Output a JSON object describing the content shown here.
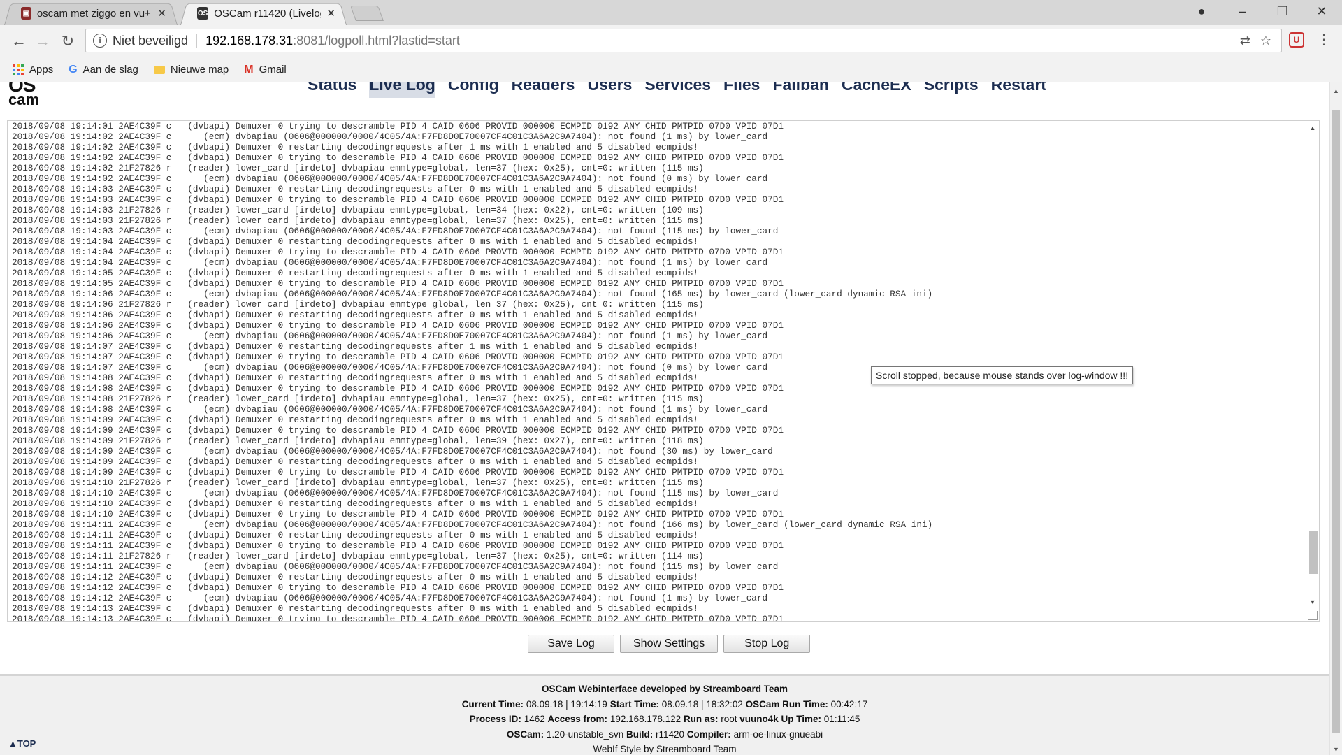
{
  "browser": {
    "tabs": [
      {
        "title": "oscam met ziggo en vu+ s",
        "favicon": "tv-icon",
        "active": false
      },
      {
        "title": "OSCam r11420 (Livelog)",
        "favicon": "oscam-icon",
        "active": true
      }
    ],
    "security_label": "Niet beveiligd",
    "url_host": "192.168.178.31",
    "url_rest": ":8081/logpoll.html?lastid=start",
    "bookmarks": [
      {
        "label": "Apps",
        "icon": "apps-grid-icon"
      },
      {
        "label": "Aan de slag",
        "icon": "google-icon"
      },
      {
        "label": "Nieuwe map",
        "icon": "folder-icon"
      },
      {
        "label": "Gmail",
        "icon": "gmail-icon"
      }
    ]
  },
  "oscam": {
    "logo_line1": "OS",
    "logo_line2": "cam",
    "menu": [
      "Status",
      "Live Log",
      "Config",
      "Readers",
      "Users",
      "Services",
      "Files",
      "Failban",
      "CacheEX",
      "Scripts",
      "Restart"
    ],
    "active_menu": "Live Log",
    "log_lines": [
      "2018/09/08 19:14:01 2AE4C39F c   (dvbapi) Demuxer 0 trying to descramble PID 4 CAID 0606 PROVID 000000 ECMPID 0192 ANY CHID PMTPID 07D0 VPID 07D1",
      "2018/09/08 19:14:02 2AE4C39F c      (ecm) dvbapiau (0606@000000/0000/4C05/4A:F7FD8D0E70007CF4C01C3A6A2C9A7404): not found (1 ms) by lower_card",
      "2018/09/08 19:14:02 2AE4C39F c   (dvbapi) Demuxer 0 restarting decodingrequests after 1 ms with 1 enabled and 5 disabled ecmpids!",
      "2018/09/08 19:14:02 2AE4C39F c   (dvbapi) Demuxer 0 trying to descramble PID 4 CAID 0606 PROVID 000000 ECMPID 0192 ANY CHID PMTPID 07D0 VPID 07D1",
      "2018/09/08 19:14:02 21F27826 r   (reader) lower_card [irdeto] dvbapiau emmtype=global, len=37 (hex: 0x25), cnt=0: written (115 ms)",
      "2018/09/08 19:14:02 2AE4C39F c      (ecm) dvbapiau (0606@000000/0000/4C05/4A:F7FD8D0E70007CF4C01C3A6A2C9A7404): not found (0 ms) by lower_card",
      "2018/09/08 19:14:03 2AE4C39F c   (dvbapi) Demuxer 0 restarting decodingrequests after 0 ms with 1 enabled and 5 disabled ecmpids!",
      "2018/09/08 19:14:03 2AE4C39F c   (dvbapi) Demuxer 0 trying to descramble PID 4 CAID 0606 PROVID 000000 ECMPID 0192 ANY CHID PMTPID 07D0 VPID 07D1",
      "2018/09/08 19:14:03 21F27826 r   (reader) lower_card [irdeto] dvbapiau emmtype=global, len=34 (hex: 0x22), cnt=0: written (109 ms)",
      "2018/09/08 19:14:03 21F27826 r   (reader) lower_card [irdeto] dvbapiau emmtype=global, len=37 (hex: 0x25), cnt=0: written (115 ms)",
      "2018/09/08 19:14:03 2AE4C39F c      (ecm) dvbapiau (0606@000000/0000/4C05/4A:F7FD8D0E70007CF4C01C3A6A2C9A7404): not found (115 ms) by lower_card",
      "2018/09/08 19:14:04 2AE4C39F c   (dvbapi) Demuxer 0 restarting decodingrequests after 0 ms with 1 enabled and 5 disabled ecmpids!",
      "2018/09/08 19:14:04 2AE4C39F c   (dvbapi) Demuxer 0 trying to descramble PID 4 CAID 0606 PROVID 000000 ECMPID 0192 ANY CHID PMTPID 07D0 VPID 07D1",
      "2018/09/08 19:14:04 2AE4C39F c      (ecm) dvbapiau (0606@000000/0000/4C05/4A:F7FD8D0E70007CF4C01C3A6A2C9A7404): not found (1 ms) by lower_card",
      "2018/09/08 19:14:05 2AE4C39F c   (dvbapi) Demuxer 0 restarting decodingrequests after 0 ms with 1 enabled and 5 disabled ecmpids!",
      "2018/09/08 19:14:05 2AE4C39F c   (dvbapi) Demuxer 0 trying to descramble PID 4 CAID 0606 PROVID 000000 ECMPID 0192 ANY CHID PMTPID 07D0 VPID 07D1",
      "2018/09/08 19:14:06 2AE4C39F c      (ecm) dvbapiau (0606@000000/0000/4C05/4A:F7FD8D0E70007CF4C01C3A6A2C9A7404): not found (165 ms) by lower_card (lower_card dynamic RSA ini)",
      "2018/09/08 19:14:06 21F27826 r   (reader) lower_card [irdeto] dvbapiau emmtype=global, len=37 (hex: 0x25), cnt=0: written (115 ms)",
      "2018/09/08 19:14:06 2AE4C39F c   (dvbapi) Demuxer 0 restarting decodingrequests after 0 ms with 1 enabled and 5 disabled ecmpids!",
      "2018/09/08 19:14:06 2AE4C39F c   (dvbapi) Demuxer 0 trying to descramble PID 4 CAID 0606 PROVID 000000 ECMPID 0192 ANY CHID PMTPID 07D0 VPID 07D1",
      "2018/09/08 19:14:06 2AE4C39F c      (ecm) dvbapiau (0606@000000/0000/4C05/4A:F7FD8D0E70007CF4C01C3A6A2C9A7404): not found (1 ms) by lower_card",
      "2018/09/08 19:14:07 2AE4C39F c   (dvbapi) Demuxer 0 restarting decodingrequests after 1 ms with 1 enabled and 5 disabled ecmpids!",
      "2018/09/08 19:14:07 2AE4C39F c   (dvbapi) Demuxer 0 trying to descramble PID 4 CAID 0606 PROVID 000000 ECMPID 0192 ANY CHID PMTPID 07D0 VPID 07D1",
      "2018/09/08 19:14:07 2AE4C39F c      (ecm) dvbapiau (0606@000000/0000/4C05/4A:F7FD8D0E70007CF4C01C3A6A2C9A7404): not found (0 ms) by lower_card",
      "2018/09/08 19:14:08 2AE4C39F c   (dvbapi) Demuxer 0 restarting decodingrequests after 0 ms with 1 enabled and 5 disabled ecmpids!",
      "2018/09/08 19:14:08 2AE4C39F c   (dvbapi) Demuxer 0 trying to descramble PID 4 CAID 0606 PROVID 000000 ECMPID 0192 ANY CHID PMTPID 07D0 VPID 07D1",
      "2018/09/08 19:14:08 21F27826 r   (reader) lower_card [irdeto] dvbapiau emmtype=global, len=37 (hex: 0x25), cnt=0: written (115 ms)",
      "2018/09/08 19:14:08 2AE4C39F c      (ecm) dvbapiau (0606@000000/0000/4C05/4A:F7FD8D0E70007CF4C01C3A6A2C9A7404): not found (1 ms) by lower_card",
      "2018/09/08 19:14:09 2AE4C39F c   (dvbapi) Demuxer 0 restarting decodingrequests after 0 ms with 1 enabled and 5 disabled ecmpids!",
      "2018/09/08 19:14:09 2AE4C39F c   (dvbapi) Demuxer 0 trying to descramble PID 4 CAID 0606 PROVID 000000 ECMPID 0192 ANY CHID PMTPID 07D0 VPID 07D1",
      "2018/09/08 19:14:09 21F27826 r   (reader) lower_card [irdeto] dvbapiau emmtype=global, len=39 (hex: 0x27), cnt=0: written (118 ms)",
      "2018/09/08 19:14:09 2AE4C39F c      (ecm) dvbapiau (0606@000000/0000/4C05/4A:F7FD8D0E70007CF4C01C3A6A2C9A7404): not found (30 ms) by lower_card",
      "2018/09/08 19:14:09 2AE4C39F c   (dvbapi) Demuxer 0 restarting decodingrequests after 0 ms with 1 enabled and 5 disabled ecmpids!",
      "2018/09/08 19:14:09 2AE4C39F c   (dvbapi) Demuxer 0 trying to descramble PID 4 CAID 0606 PROVID 000000 ECMPID 0192 ANY CHID PMTPID 07D0 VPID 07D1",
      "2018/09/08 19:14:10 21F27826 r   (reader) lower_card [irdeto] dvbapiau emmtype=global, len=37 (hex: 0x25), cnt=0: written (115 ms)",
      "2018/09/08 19:14:10 2AE4C39F c      (ecm) dvbapiau (0606@000000/0000/4C05/4A:F7FD8D0E70007CF4C01C3A6A2C9A7404): not found (115 ms) by lower_card",
      "2018/09/08 19:14:10 2AE4C39F c   (dvbapi) Demuxer 0 restarting decodingrequests after 0 ms with 1 enabled and 5 disabled ecmpids!",
      "2018/09/08 19:14:10 2AE4C39F c   (dvbapi) Demuxer 0 trying to descramble PID 4 CAID 0606 PROVID 000000 ECMPID 0192 ANY CHID PMTPID 07D0 VPID 07D1",
      "2018/09/08 19:14:11 2AE4C39F c      (ecm) dvbapiau (0606@000000/0000/4C05/4A:F7FD8D0E70007CF4C01C3A6A2C9A7404): not found (166 ms) by lower_card (lower_card dynamic RSA ini)",
      "2018/09/08 19:14:11 2AE4C39F c   (dvbapi) Demuxer 0 restarting decodingrequests after 0 ms with 1 enabled and 5 disabled ecmpids!",
      "2018/09/08 19:14:11 2AE4C39F c   (dvbapi) Demuxer 0 trying to descramble PID 4 CAID 0606 PROVID 000000 ECMPID 0192 ANY CHID PMTPID 07D0 VPID 07D1",
      "2018/09/08 19:14:11 21F27826 r   (reader) lower_card [irdeto] dvbapiau emmtype=global, len=37 (hex: 0x25), cnt=0: written (114 ms)",
      "2018/09/08 19:14:11 2AE4C39F c      (ecm) dvbapiau (0606@000000/0000/4C05/4A:F7FD8D0E70007CF4C01C3A6A2C9A7404): not found (115 ms) by lower_card",
      "2018/09/08 19:14:12 2AE4C39F c   (dvbapi) Demuxer 0 restarting decodingrequests after 0 ms with 1 enabled and 5 disabled ecmpids!",
      "2018/09/08 19:14:12 2AE4C39F c   (dvbapi) Demuxer 0 trying to descramble PID 4 CAID 0606 PROVID 000000 ECMPID 0192 ANY CHID PMTPID 07D0 VPID 07D1",
      "2018/09/08 19:14:12 2AE4C39F c      (ecm) dvbapiau (0606@000000/0000/4C05/4A:F7FD8D0E70007CF4C01C3A6A2C9A7404): not found (1 ms) by lower_card",
      "2018/09/08 19:14:13 2AE4C39F c   (dvbapi) Demuxer 0 restarting decodingrequests after 0 ms with 1 enabled and 5 disabled ecmpids!",
      "2018/09/08 19:14:13 2AE4C39F c   (dvbapi) Demuxer 0 trying to descramble PID 4 CAID 0606 PROVID 000000 ECMPID 0192 ANY CHID PMTPID 07D0 VPID 07D1"
    ],
    "tooltip": "Scroll stopped, because mouse stands over log-window !!!",
    "buttons": {
      "save": "Save Log",
      "settings": "Show Settings",
      "stop": "Stop Log"
    },
    "footer": {
      "credit": "OSCam Webinterface developed by Streamboard Team",
      "current_time_label": "Current Time:",
      "current_time": "08.09.18 | 19:14:19",
      "start_time_label": "Start Time:",
      "start_time": "08.09.18 | 18:32:02",
      "run_time_label": "OSCam Run Time:",
      "run_time": "00:42:17",
      "pid_label": "Process ID:",
      "pid": "1462",
      "access_label": "Access from:",
      "access": "192.168.178.122",
      "runas_label": "Run as:",
      "runas": "root",
      "host_label": "vuuno4k Up Time:",
      "uptime": "01:11:45",
      "oscam_label": "OSCam:",
      "oscam_version": "1.20-unstable_svn",
      "build_label": "Build:",
      "build": "r11420",
      "compiler_label": "Compiler:",
      "compiler": "arm-oe-linux-gnueabi",
      "style_credit": "WebIf Style by Streamboard Team",
      "top_link": "▲TOP"
    }
  }
}
